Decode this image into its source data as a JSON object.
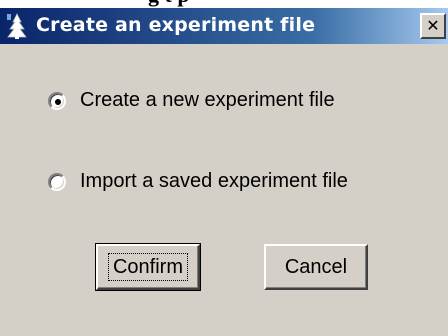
{
  "background_caption": "g  t   p",
  "window": {
    "title": "Create an experiment file",
    "icon": "app-tree-icon",
    "close_glyph": "✕"
  },
  "options": [
    {
      "label": "Create a new experiment file",
      "selected": true
    },
    {
      "label": "Import a saved experiment file",
      "selected": false
    }
  ],
  "buttons": {
    "confirm_label": "Confirm",
    "cancel_label": "Cancel"
  },
  "colors": {
    "face": "#d4d0c8",
    "titlebar_start": "#0a246a",
    "titlebar_end": "#a6caf0"
  }
}
